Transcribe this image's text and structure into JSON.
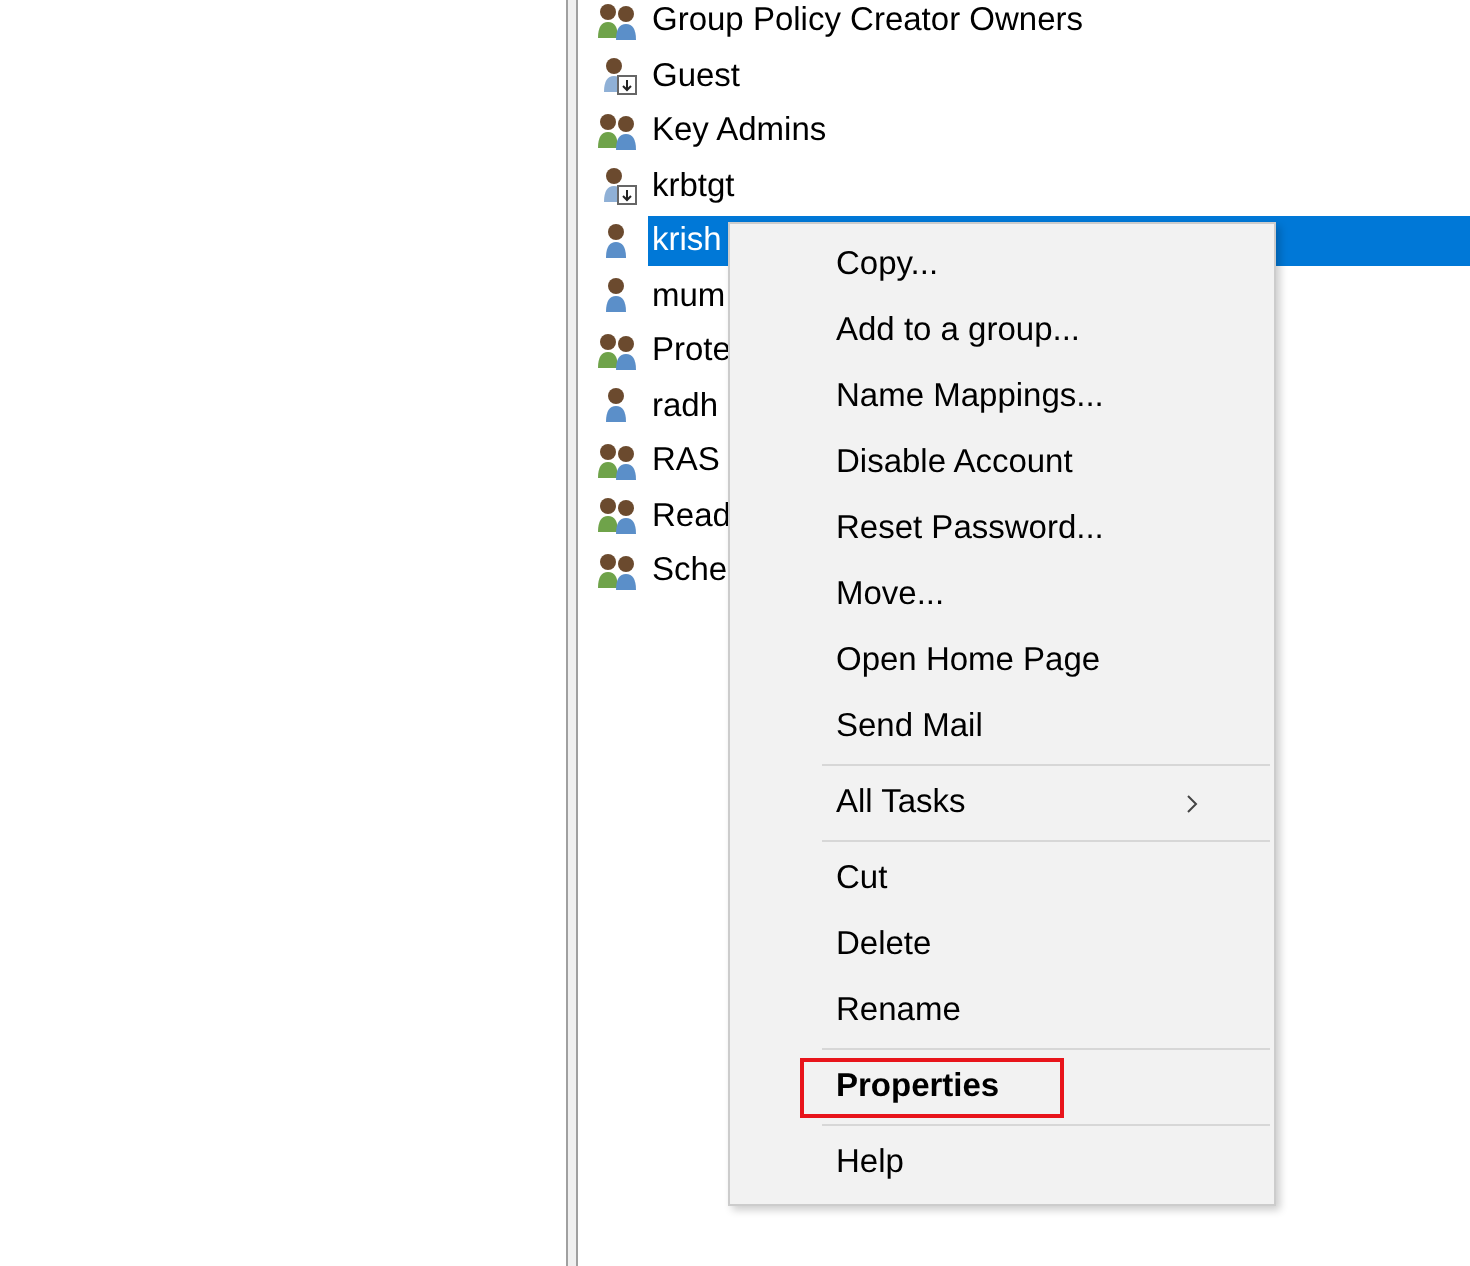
{
  "list": [
    {
      "label": "Group Policy Creator Owners",
      "kind": "group",
      "selected": false
    },
    {
      "label": "Guest",
      "kind": "disabled-user",
      "selected": false
    },
    {
      "label": "Key Admins",
      "kind": "group",
      "selected": false
    },
    {
      "label": "krbtgt",
      "kind": "disabled-user",
      "selected": false
    },
    {
      "label": "krish",
      "kind": "user",
      "selected": true
    },
    {
      "label": "mum",
      "kind": "user",
      "selected": false
    },
    {
      "label": "Prote",
      "kind": "group",
      "selected": false
    },
    {
      "label": "radh",
      "kind": "user",
      "selected": false
    },
    {
      "label": "RAS",
      "kind": "group",
      "selected": false
    },
    {
      "label": "Read",
      "kind": "group",
      "selected": false
    },
    {
      "label": "Sche",
      "kind": "group",
      "selected": false
    }
  ],
  "context_menu": [
    {
      "kind": "item",
      "label": "Copy..."
    },
    {
      "kind": "item",
      "label": "Add to a group..."
    },
    {
      "kind": "item",
      "label": "Name Mappings..."
    },
    {
      "kind": "item",
      "label": "Disable Account"
    },
    {
      "kind": "item",
      "label": "Reset Password..."
    },
    {
      "kind": "item",
      "label": "Move..."
    },
    {
      "kind": "item",
      "label": "Open Home Page"
    },
    {
      "kind": "item",
      "label": "Send Mail"
    },
    {
      "kind": "separator"
    },
    {
      "kind": "item",
      "label": "All Tasks",
      "submenu": true
    },
    {
      "kind": "separator"
    },
    {
      "kind": "item",
      "label": "Cut"
    },
    {
      "kind": "item",
      "label": "Delete"
    },
    {
      "kind": "item",
      "label": "Rename"
    },
    {
      "kind": "separator"
    },
    {
      "kind": "item",
      "label": "Properties",
      "bold": true,
      "highlighted": true
    },
    {
      "kind": "separator"
    },
    {
      "kind": "item",
      "label": "Help"
    }
  ]
}
